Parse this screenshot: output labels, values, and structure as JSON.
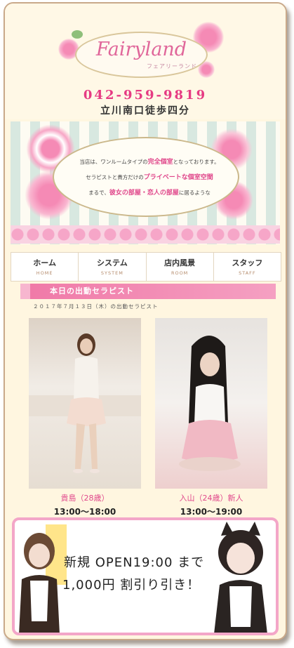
{
  "header": {
    "logo": "Fairyland",
    "logo_kana": "フェアリーランド",
    "phone": "042-959-9819",
    "address": "立川南口徒歩四分"
  },
  "banner": {
    "line1_pre": "当店は、ワンルームタイプの",
    "line1_highlight": "完全個室",
    "line1_post": "となっております。",
    "line2_pre": "セラピストと貴方だけの",
    "line2_highlight": "プライベートな個室空間",
    "line3_pre": "まるで、",
    "line3_highlight": "彼女の部屋・恋人の部屋",
    "line3_post": "に居るような"
  },
  "nav": [
    {
      "label": "ホーム",
      "sub": "HOME"
    },
    {
      "label": "システム",
      "sub": "SYSTEM"
    },
    {
      "label": "店内風景",
      "sub": "ROOM"
    },
    {
      "label": "スタッフ",
      "sub": "STAFF"
    }
  ],
  "today": {
    "title": "本日の出動セラピスト",
    "date_line": "２０１７年７月１３日（木）の出動セラピスト",
    "therapists": [
      {
        "name": "貴島（28歳）",
        "time": "13:00～18:00"
      },
      {
        "name": "入山（24歳）新人",
        "time": "13:00～19:00"
      }
    ]
  },
  "promo": {
    "line1": "新規 OPEN19:00 まで",
    "line2": "1,000円 割引り引き！"
  },
  "colors": {
    "accent": "#e0478b",
    "frame": "#fff6e0"
  }
}
